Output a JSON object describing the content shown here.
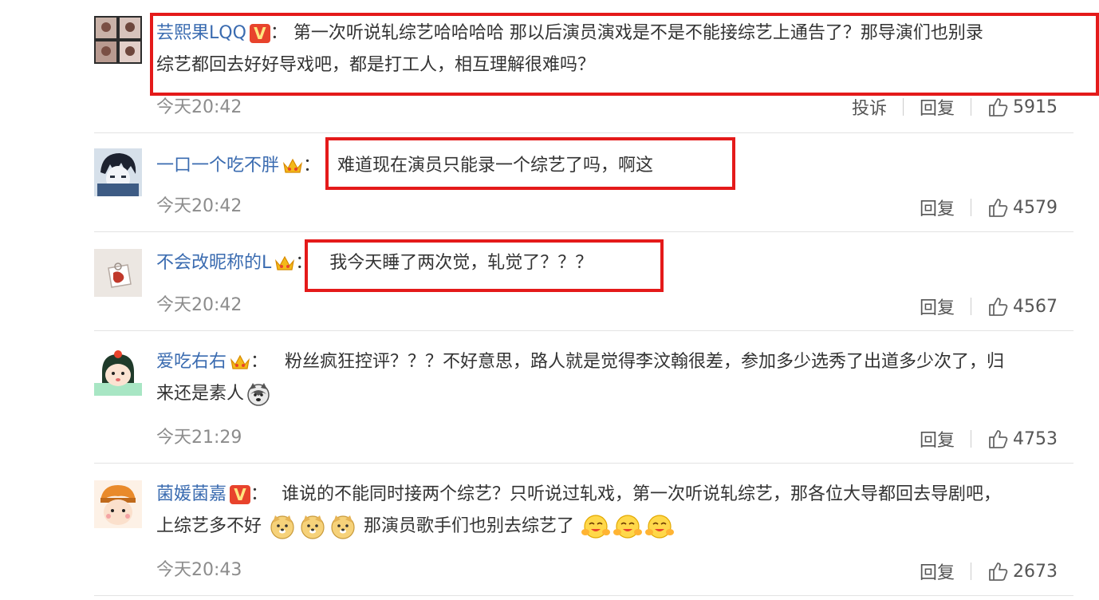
{
  "comments": [
    {
      "username": "芸熙果LQQ",
      "badge": "V",
      "colon": "：",
      "text_line1": "第一次听说轧综艺哈哈哈哈 那以后演员演戏是不是不能接综艺上通告了？那导演们也别录",
      "text_line2": "综艺都回去好好导戏吧，都是打工人，相互理解很难吗？",
      "time": "今天20:42",
      "report_label": "投诉",
      "reply_label": "回复",
      "likes": "5915"
    },
    {
      "username": "一口一个吃不胖",
      "badge": "crown",
      "colon": "：",
      "text_line1": "难道现在演员只能录一个综艺了吗，啊这",
      "time": "今天20:42",
      "reply_label": "回复",
      "likes": "4579"
    },
    {
      "username": "不会改昵称的L",
      "badge": "crown",
      "colon": "：",
      "text_line1": "我今天睡了两次觉，轧觉了？？？",
      "time": "今天20:42",
      "reply_label": "回复",
      "likes": "4567"
    },
    {
      "username": "爱吃右右",
      "badge": "crown",
      "colon": "：",
      "text_line1": "粉丝疯狂控评？？？不好意思，路人就是觉得李汶翰很差，参加多少选秀了出道多少次了，归",
      "text_line2": "来还是素人",
      "time": "今天21:29",
      "reply_label": "回复",
      "likes": "4753"
    },
    {
      "username": "菌媛菌嘉",
      "badge": "V",
      "colon": "：",
      "text_line1": "谁说的不能同时接两个综艺？只听说过轧戏，第一次听说轧综艺，那各位大导都回去导剧吧，",
      "text_line2a": "上综艺多不好",
      "text_line2b": "那演员歌手们也别去综艺了",
      "time": "今天20:43",
      "reply_label": "回复",
      "likes": "2673"
    }
  ],
  "colors": {
    "username": "#3a6bb0",
    "highlight_box": "#e41a1a",
    "time": "#8c8c8c"
  }
}
